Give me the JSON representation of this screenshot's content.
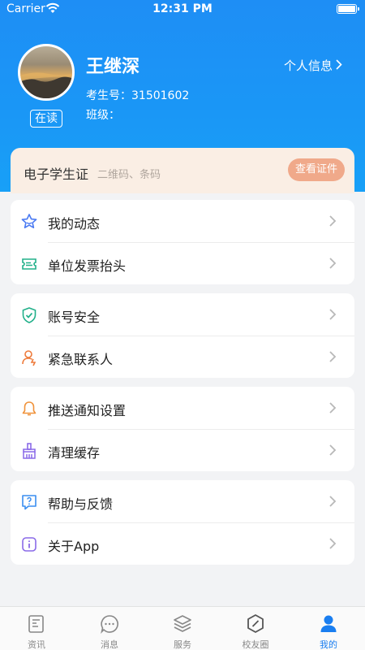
{
  "status_bar": {
    "carrier": "Carrier",
    "time": "12:31 PM"
  },
  "profile": {
    "name": "王继深",
    "status": "在读",
    "link_label": "个人信息",
    "exam_no": "考生号：31501602",
    "class": "班级："
  },
  "id_card": {
    "title": "电子学生证",
    "subtitle": "二维码、条码",
    "button": "查看证件"
  },
  "menu_groups": [
    {
      "items": [
        {
          "label": "我的动态",
          "icon": "star-icon"
        },
        {
          "label": "单位发票抬头",
          "icon": "ticket-icon"
        }
      ]
    },
    {
      "items": [
        {
          "label": "账号安全",
          "icon": "shield-check-icon"
        },
        {
          "label": "紧急联系人",
          "icon": "contact-icon"
        }
      ]
    },
    {
      "items": [
        {
          "label": "推送通知设置",
          "icon": "bell-icon"
        },
        {
          "label": "清理缓存",
          "icon": "broom-icon"
        }
      ]
    },
    {
      "items": [
        {
          "label": "帮助与反馈",
          "icon": "help-icon"
        },
        {
          "label": "关于App",
          "icon": "info-icon"
        }
      ]
    }
  ],
  "tabs": [
    {
      "label": "资讯",
      "icon": "news-icon"
    },
    {
      "label": "消息",
      "icon": "chat-icon"
    },
    {
      "label": "服务",
      "icon": "layers-icon"
    },
    {
      "label": "校友圈",
      "icon": "compass-icon"
    },
    {
      "label": "我的",
      "icon": "user-icon",
      "active": true
    }
  ],
  "colors": {
    "primary": "#1a8ff5",
    "accent_orange": "#f0a98a",
    "active_tab": "#1a7ef0"
  }
}
